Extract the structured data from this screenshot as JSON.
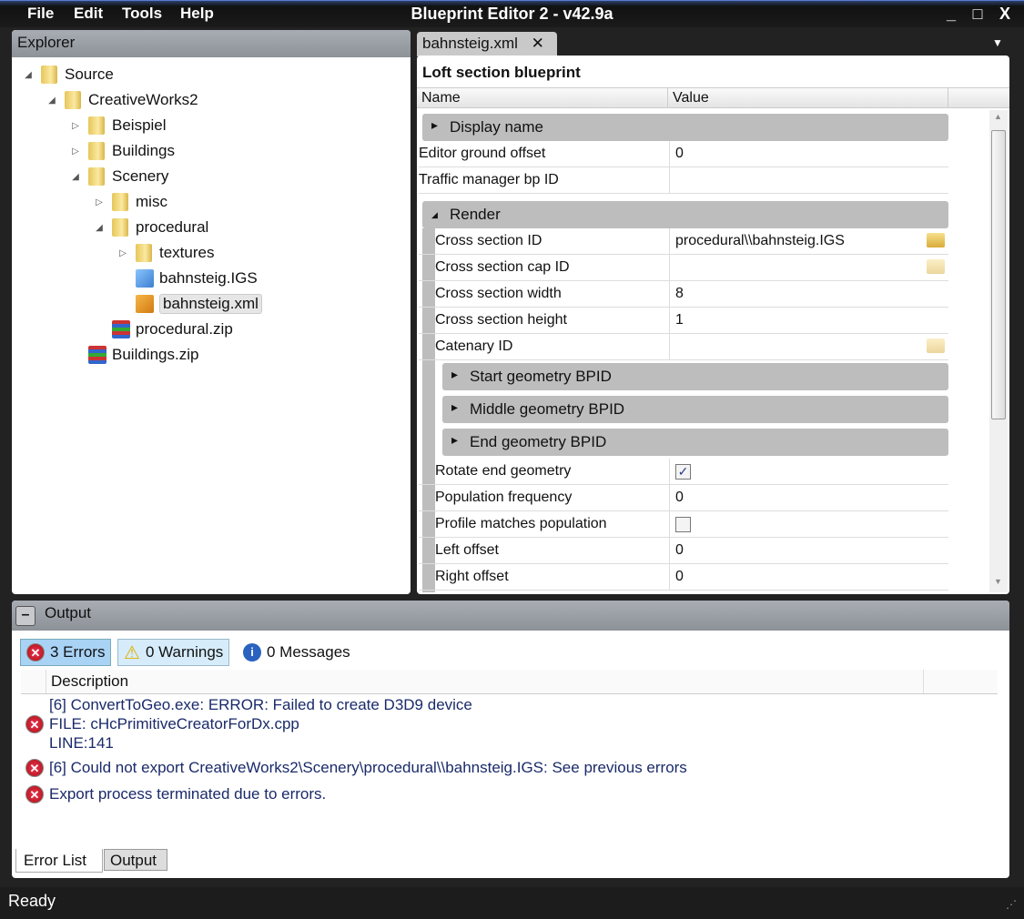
{
  "window": {
    "title": "Blueprint Editor 2 - v42.9a",
    "menu": [
      "File",
      "Edit",
      "Tools",
      "Help"
    ],
    "minimize": "_",
    "maximize": "□",
    "close": "X"
  },
  "explorer": {
    "title": "Explorer",
    "items": [
      {
        "label": "Source",
        "depth": 0,
        "exp": "open",
        "icon": "folder"
      },
      {
        "label": "CreativeWorks2",
        "depth": 1,
        "exp": "open",
        "icon": "folder"
      },
      {
        "label": "Beispiel",
        "depth": 2,
        "exp": "closed",
        "icon": "folder"
      },
      {
        "label": "Buildings",
        "depth": 2,
        "exp": "closed",
        "icon": "folder"
      },
      {
        "label": "Scenery",
        "depth": 2,
        "exp": "open",
        "icon": "folder"
      },
      {
        "label": "misc",
        "depth": 3,
        "exp": "closed",
        "icon": "folder"
      },
      {
        "label": "procedural",
        "depth": 3,
        "exp": "open",
        "icon": "folder"
      },
      {
        "label": "textures",
        "depth": 4,
        "exp": "closed",
        "icon": "folder"
      },
      {
        "label": "bahnsteig.IGS",
        "depth": 4,
        "exp": "none",
        "icon": "igs"
      },
      {
        "label": "bahnsteig.xml",
        "depth": 4,
        "exp": "none",
        "icon": "xml",
        "selected": true
      },
      {
        "label": "procedural.zip",
        "depth": 3,
        "exp": "none",
        "icon": "zip"
      },
      {
        "label": "Buildings.zip",
        "depth": 2,
        "exp": "none",
        "icon": "zip"
      }
    ]
  },
  "editor": {
    "tab": "bahnsteig.xml",
    "tab_close": "✕",
    "heading": "Loft section blueprint",
    "col_name": "Name",
    "col_value": "Value",
    "rows": [
      {
        "type": "cat",
        "label": "Display name",
        "indent": 0,
        "open": false
      },
      {
        "type": "prop",
        "label": "Editor ground offset",
        "value": "0",
        "indent": 0
      },
      {
        "type": "prop",
        "label": "Traffic manager bp ID",
        "value": "",
        "indent": 0
      },
      {
        "type": "gap"
      },
      {
        "type": "cat",
        "label": "Render",
        "indent": 0,
        "open": true
      },
      {
        "type": "prop",
        "label": "Cross section ID",
        "value": "procedural\\\\bahnsteig.IGS",
        "indent": 1,
        "browse": true
      },
      {
        "type": "prop",
        "label": "Cross section cap ID",
        "value": "",
        "indent": 1,
        "browse": true
      },
      {
        "type": "prop",
        "label": "Cross section width",
        "value": "8",
        "indent": 1
      },
      {
        "type": "prop",
        "label": "Cross section height",
        "value": "1",
        "indent": 1
      },
      {
        "type": "prop",
        "label": "Catenary ID",
        "value": "",
        "indent": 1,
        "browse": true
      },
      {
        "type": "cat",
        "label": "Start geometry BPID",
        "indent": 1,
        "open": false
      },
      {
        "type": "cat",
        "label": "Middle geometry BPID",
        "indent": 1,
        "open": false
      },
      {
        "type": "cat",
        "label": "End geometry BPID",
        "indent": 1,
        "open": false
      },
      {
        "type": "check",
        "label": "Rotate end geometry",
        "checked": true,
        "indent": 1
      },
      {
        "type": "prop",
        "label": "Population frequency",
        "value": "0",
        "indent": 1
      },
      {
        "type": "check",
        "label": "Profile matches population",
        "checked": false,
        "indent": 1
      },
      {
        "type": "prop",
        "label": "Left offset",
        "value": "0",
        "indent": 1
      },
      {
        "type": "prop",
        "label": "Right offset",
        "value": "0",
        "indent": 1
      }
    ]
  },
  "output": {
    "title": "Output",
    "collapse": "–",
    "errors": "3 Errors",
    "warnings": "0 Warnings",
    "messages": "0 Messages",
    "col_desc": "Description",
    "entries": [
      "[6] ConvertToGeo.exe: ERROR: Failed to create D3D9 device\nFILE: cHcPrimitiveCreatorForDx.cpp\nLINE:141",
      "[6] Could not export CreativeWorks2\\Scenery\\procedural\\\\bahnsteig.IGS: See previous errors",
      "Export process terminated due to errors."
    ],
    "tabs": [
      "Error List",
      "Output"
    ]
  },
  "status": "Ready"
}
